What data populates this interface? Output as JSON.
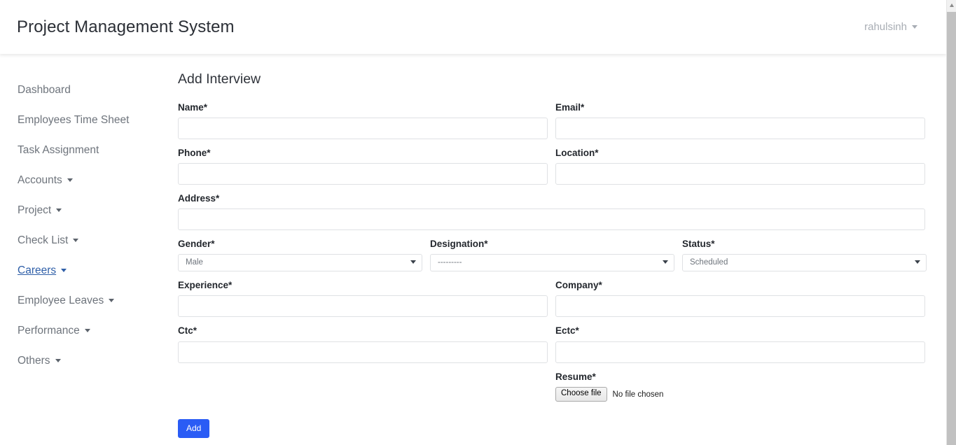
{
  "navbar": {
    "brand": "Project Management System",
    "user": "rahulsinh"
  },
  "sidebar": {
    "items": [
      {
        "label": "Dashboard",
        "has_caret": false,
        "active": false
      },
      {
        "label": "Employees Time Sheet",
        "has_caret": false,
        "active": false
      },
      {
        "label": "Task Assignment",
        "has_caret": false,
        "active": false
      },
      {
        "label": "Accounts",
        "has_caret": true,
        "active": false
      },
      {
        "label": "Project",
        "has_caret": true,
        "active": false
      },
      {
        "label": "Check List",
        "has_caret": true,
        "active": false
      },
      {
        "label": "Careers",
        "has_caret": true,
        "active": true
      },
      {
        "label": "Employee Leaves",
        "has_caret": true,
        "active": false
      },
      {
        "label": "Performance",
        "has_caret": true,
        "active": false
      },
      {
        "label": "Others",
        "has_caret": true,
        "active": false
      }
    ]
  },
  "main": {
    "title": "Add Interview",
    "fields": {
      "name": {
        "label": "Name*",
        "value": "",
        "placeholder": ""
      },
      "email": {
        "label": "Email*",
        "value": "",
        "placeholder": ""
      },
      "phone": {
        "label": "Phone*",
        "value": "",
        "placeholder": ""
      },
      "location": {
        "label": "Location*",
        "value": "",
        "placeholder": ""
      },
      "address": {
        "label": "Address*",
        "value": "",
        "placeholder": ""
      },
      "gender": {
        "label": "Gender*",
        "selected": "Male"
      },
      "designation": {
        "label": "Designation*",
        "selected": "---------"
      },
      "status": {
        "label": "Status*",
        "selected": "Scheduled"
      },
      "experience": {
        "label": "Experience*",
        "value": "",
        "placeholder": ""
      },
      "company": {
        "label": "Company*",
        "value": "",
        "placeholder": ""
      },
      "ctc": {
        "label": "Ctc*",
        "value": "",
        "placeholder": ""
      },
      "ectc": {
        "label": "Ectc*",
        "value": "",
        "placeholder": ""
      },
      "resume": {
        "label": "Resume*",
        "button_label": "Choose file",
        "status_text": "No file chosen"
      }
    },
    "submit_label": "Add"
  },
  "colors": {
    "primary": "#2a5cf5",
    "link": "#2f5fa8",
    "muted": "#6e747c"
  }
}
